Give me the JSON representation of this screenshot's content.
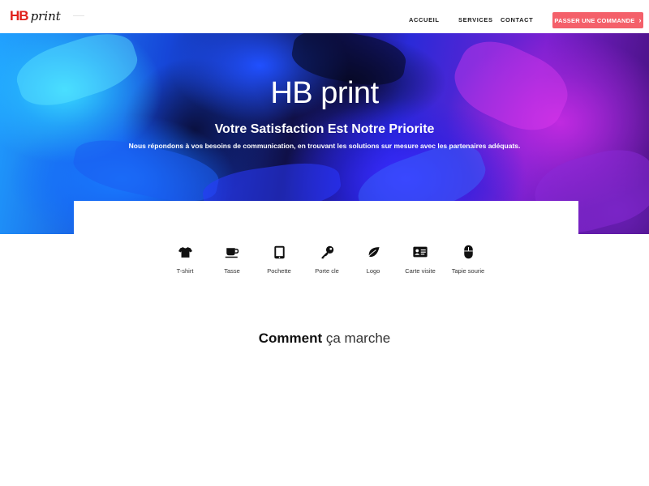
{
  "brand": {
    "hb": "HB",
    "print": "print"
  },
  "nav": {
    "items": [
      {
        "label": "ACCUEIL"
      },
      {
        "label": "SERVICES"
      },
      {
        "label": "CONTACT"
      }
    ],
    "cta_label": "PASSER UNE COMMANDE",
    "cta_icon": "chevron-right-icon",
    "cta_color": "#f4606a"
  },
  "hero": {
    "title": "HB print",
    "subtitle": "Votre Satisfaction Est Notre Priorite",
    "description": "Nous répondons à vos besoins de communication, en trouvant les solutions sur mesure avec les partenaires adéquats."
  },
  "services": [
    {
      "label": "T-shirt",
      "icon": "tshirt-icon"
    },
    {
      "label": "Tasse",
      "icon": "mug-icon"
    },
    {
      "label": "Pochette",
      "icon": "tablet-icon"
    },
    {
      "label": "Porte cle",
      "icon": "key-icon"
    },
    {
      "label": "Logo",
      "icon": "leaf-icon"
    },
    {
      "label": "Carte visite",
      "icon": "id-card-icon"
    },
    {
      "label": "Tapie sourie",
      "icon": "mouse-icon"
    }
  ],
  "how": {
    "strong": "Comment",
    "light": "ça marche"
  }
}
